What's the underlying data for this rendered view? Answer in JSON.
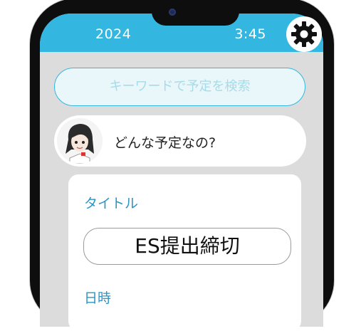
{
  "status_bar": {
    "time_left": "2024",
    "time_right": "3:45"
  },
  "search": {
    "placeholder": "キーワードで予定を検索"
  },
  "assistant": {
    "message": "どんな予定なの?"
  },
  "form": {
    "title_label": "タイトル",
    "title_value": "ES提出締切",
    "datetime_label": "日時"
  },
  "icons": {
    "settings": "gear-icon",
    "assistant": "avatar"
  },
  "colors": {
    "accent": "#33b7e0",
    "label": "#2b95c6",
    "background": "#dcdcdc"
  }
}
